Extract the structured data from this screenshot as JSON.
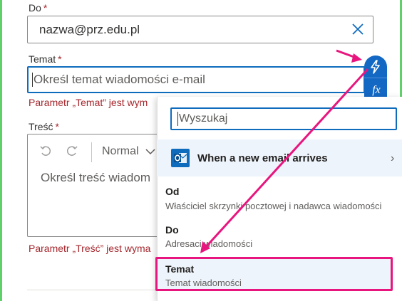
{
  "form": {
    "to": {
      "label": "Do",
      "required_mark": "*",
      "value": "nazwa@prz.edu.pl"
    },
    "subject": {
      "label": "Temat",
      "required_mark": "*",
      "placeholder": "Określ temat wiadomości e-mail",
      "error": "Parametr „Temat” jest wym"
    },
    "body": {
      "label": "Treść",
      "required_mark": "*",
      "font_style": "Normal",
      "placeholder": "Określ treść wiadom",
      "error": "Parametr „Treść” jest wyma"
    }
  },
  "dynamic": {
    "fx_label": "fx",
    "search_placeholder": "Wyszukaj",
    "section_title": "When a new email arrives",
    "items": [
      {
        "title": "Od",
        "description": "Właściciel skrzynki pocztowej i nadawca wiadomości"
      },
      {
        "title": "Do",
        "description": "Adresaci wiadomości"
      },
      {
        "title": "Temat",
        "description": "Temat wiadomości"
      }
    ]
  },
  "colors": {
    "accent": "#0f6cbd",
    "error": "#a4262c",
    "annotation": "#e8157e",
    "selection": "#eef4fb"
  },
  "icons": {
    "clear": "close-icon",
    "dynamic_content": "lightning-icon",
    "undo": "undo-icon",
    "redo": "redo-icon",
    "outlook": "outlook-icon"
  }
}
